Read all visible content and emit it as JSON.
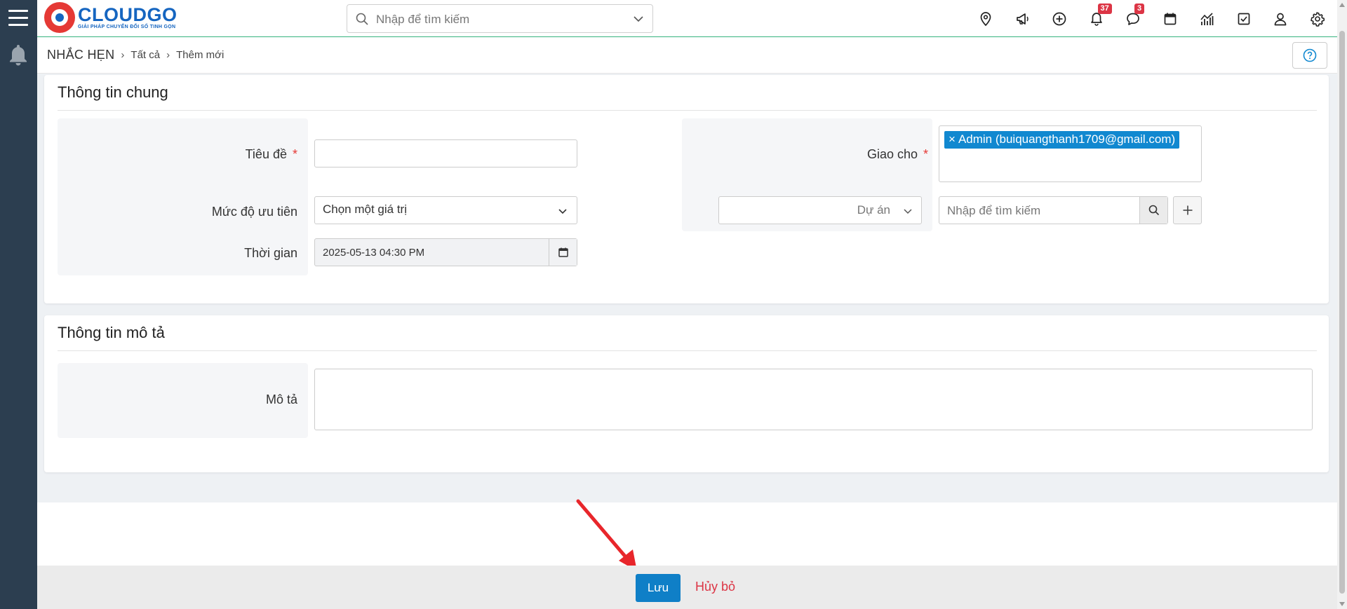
{
  "app": {
    "logo_brand": "CLOUDGO",
    "logo_tagline": "GIẢI PHÁP CHUYỂN ĐỔI SỐ TINH GỌN"
  },
  "header": {
    "search_placeholder": "Nhập để tìm kiếm",
    "icons": [
      "map-pin-icon",
      "megaphone-icon",
      "plus-circle-icon",
      "bell-icon",
      "chat-icon",
      "calendar-icon",
      "chart-icon",
      "checkbox-icon",
      "user-icon",
      "gear-icon"
    ],
    "notifications_count": "37",
    "messages_count": "3"
  },
  "breadcrumb": {
    "root": "NHẮC HẸN",
    "level1": "Tất cả",
    "level2": "Thêm mới"
  },
  "general_section": {
    "title": "Thông tin chung",
    "title_label": "Tiêu đề",
    "title_value": "",
    "required_mark": "*",
    "priority_label": "Mức độ ưu tiên",
    "priority_value": "Chọn một giá trị",
    "time_label": "Thời gian",
    "time_value": "2025-05-13 04:30 PM",
    "assign_label": "Giao cho",
    "assignee_chip": "Admin (buiquangthanh1709@gmail.com)",
    "chip_remove": "×",
    "project_select_value": "Dự án",
    "assign_search_placeholder": "Nhập để tìm kiếm"
  },
  "description_section": {
    "title": "Thông tin mô tả",
    "desc_label": "Mô tả",
    "desc_value": ""
  },
  "footer": {
    "save_label": "Lưu",
    "cancel_label": "Hủy bỏ"
  },
  "colors": {
    "sidebar": "#2c3e50",
    "primary": "#0f7fc7",
    "danger": "#dc3545",
    "header_border": "#35b37e"
  }
}
